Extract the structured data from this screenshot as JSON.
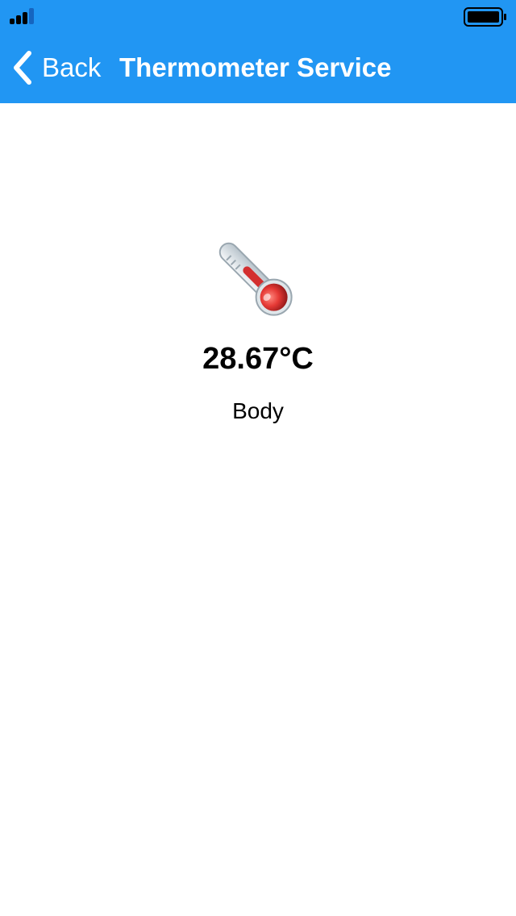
{
  "colors": {
    "header_background": "#2196F3",
    "header_text": "#ffffff",
    "body_background": "#ffffff",
    "thermometer_red": "#e53935"
  },
  "status_bar": {
    "signal_icon": "signal-bars-icon",
    "battery_icon": "battery-full-icon"
  },
  "nav": {
    "back_label": "Back",
    "back_icon": "chevron-left-icon",
    "title": "Thermometer Service"
  },
  "measurement": {
    "icon": "thermometer-icon",
    "value": "28.67°C",
    "location": "Body"
  }
}
